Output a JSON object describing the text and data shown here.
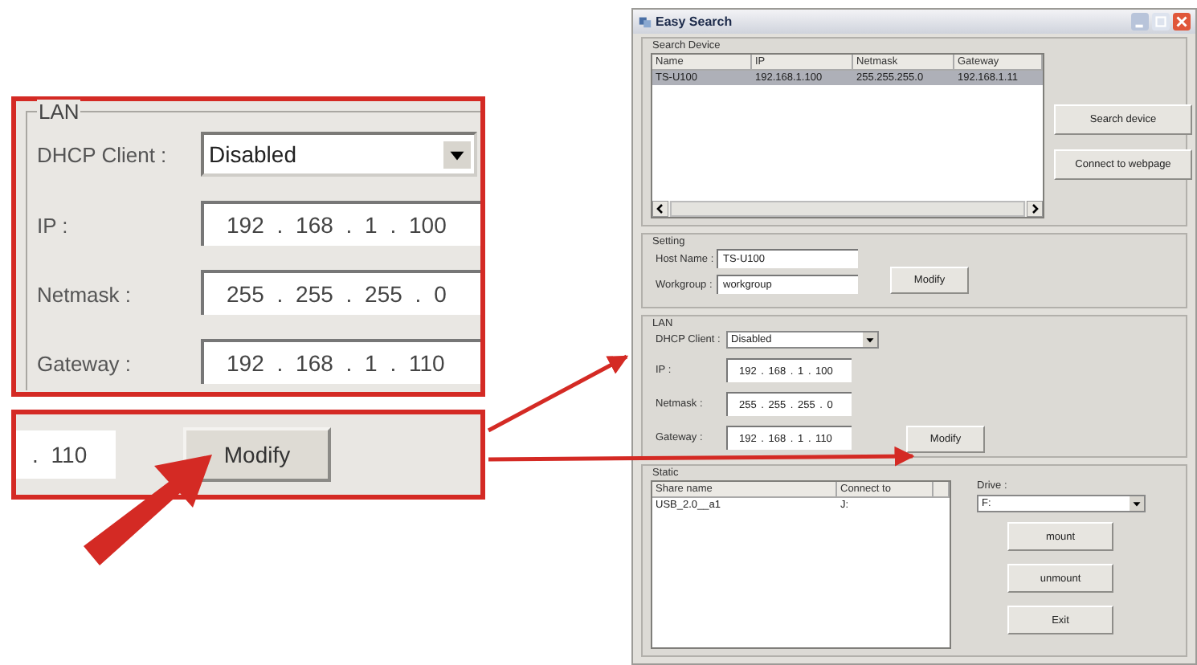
{
  "callout_lan": {
    "legend": "LAN",
    "dhcp": {
      "label": "DHCP Client :",
      "value": "Disabled"
    },
    "fields": [
      {
        "label": "IP :",
        "value": "192 . 168 . 1 . 100"
      },
      {
        "label": "Netmask :",
        "value": "255 . 255 . 255 . 0"
      },
      {
        "label": "Gateway :",
        "value": "192 . 168 . 1 . 110"
      }
    ]
  },
  "callout_modify": {
    "field_value": ". 110",
    "button": "Modify"
  },
  "window": {
    "title": "Easy Search",
    "search_device": {
      "legend": "Search Device",
      "columns": [
        "Name",
        "IP",
        "Netmask",
        "Gateway"
      ],
      "rows": [
        {
          "cells": [
            "TS-U100",
            "192.168.1.100",
            "255.255.255.0",
            "192.168.1.11"
          ],
          "selected": true
        }
      ],
      "buttons": [
        "Search device",
        "Connect to webpage"
      ]
    },
    "setting": {
      "legend": "Setting",
      "fields": [
        {
          "label": "Host Name :",
          "value": "TS-U100"
        },
        {
          "label": "Workgroup :",
          "value": "workgroup"
        }
      ],
      "button": "Modify"
    },
    "lan": {
      "legend": "LAN",
      "dhcp": {
        "label": "DHCP Client :",
        "value": "Disabled"
      },
      "fields": [
        {
          "label": "IP :",
          "value": "192 . 168 . 1 . 100"
        },
        {
          "label": "Netmask :",
          "value": "255 . 255 . 255 . 0"
        },
        {
          "label": "Gateway :",
          "value": "192 . 168 . 1 . 110"
        }
      ],
      "button": "Modify"
    },
    "static": {
      "legend": "Static",
      "columns": [
        "Share name",
        "Connect to"
      ],
      "rows": [
        {
          "cells": [
            "USB_2.0__a1",
            "J:"
          ]
        }
      ],
      "drive": {
        "label": "Drive :",
        "value": "F:"
      },
      "buttons": [
        "mount",
        "unmount",
        "Exit"
      ]
    }
  }
}
